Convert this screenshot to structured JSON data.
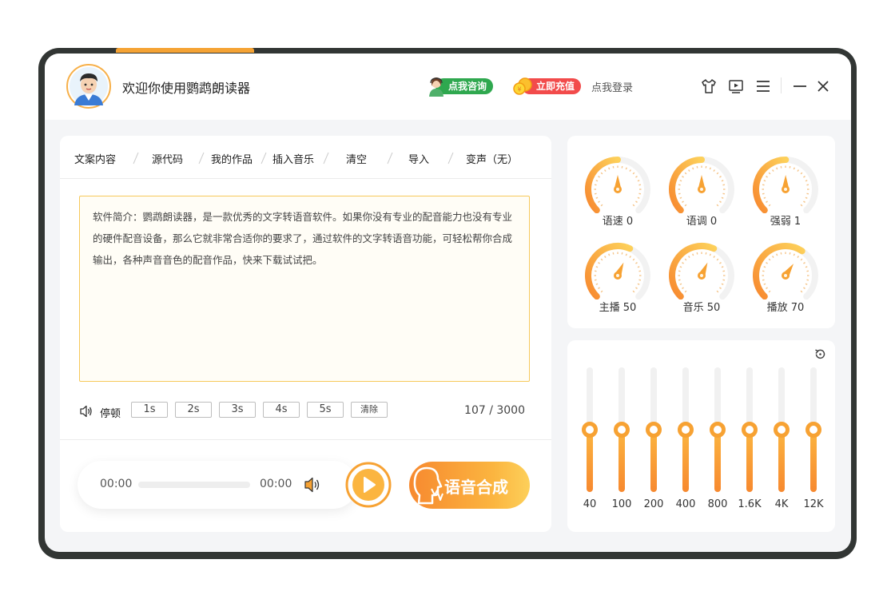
{
  "header": {
    "welcome": "欢迎你使用鹦鹉朗读器",
    "consult_label": "点我咨询",
    "recharge_label": "立即充值",
    "login_label": "点我登录"
  },
  "tabs": [
    "文案内容",
    "源代码",
    "我的作品",
    "插入音乐",
    "清空",
    "导入",
    "变声（无）"
  ],
  "editor": {
    "text": "软件简介：鹦鹉朗读器，是一款优秀的文字转语音软件。如果你没有专业的配音能力也没有专业的硬件配音设备，那么它就非常合适你的要求了，通过软件的文字转语音功能，可轻松帮你合成输出，各种声音音色的配音作品，快来下载试试把。",
    "char_count": "107 / 3000"
  },
  "pause": {
    "label": "停顿",
    "options": [
      "1s",
      "2s",
      "3s",
      "4s",
      "5s"
    ],
    "clear_label": "清除"
  },
  "player": {
    "current_time": "00:00",
    "total_time": "00:00",
    "progress": 0
  },
  "synth_label": "语音合成",
  "gauges": [
    {
      "label": "语速 0",
      "value": 0
    },
    {
      "label": "语调 0",
      "value": 0
    },
    {
      "label": "强弱 1",
      "value": 1
    },
    {
      "label": "主播 50",
      "value": 50
    },
    {
      "label": "音乐 50",
      "value": 50
    },
    {
      "label": "播放 70",
      "value": 70
    }
  ],
  "equalizer": {
    "bands": [
      "40",
      "100",
      "200",
      "400",
      "800",
      "1.6K",
      "4K",
      "12K"
    ],
    "levels": [
      0.5,
      0.5,
      0.5,
      0.5,
      0.5,
      0.5,
      0.5,
      0.5
    ]
  },
  "colors": {
    "accent": "#f7a233",
    "consult": "#2fa84f",
    "recharge": "#f24b4b"
  }
}
